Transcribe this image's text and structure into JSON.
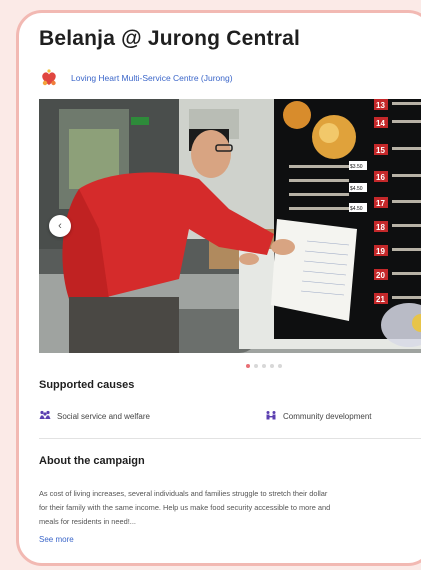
{
  "campaign": {
    "title": "Belanja @ Jurong Central",
    "organizer": "Loving Heart Multi-Service Centre (Jurong)"
  },
  "carousel": {
    "prev_label": "‹",
    "slide_count": 5,
    "active_index": 0
  },
  "supported_causes": {
    "heading": "Supported causes",
    "items": [
      {
        "label": "Social service and welfare",
        "icon": "people-icon",
        "color": "#5b3fb0"
      },
      {
        "label": "Community development",
        "icon": "community-icon",
        "color": "#5b3fb0"
      }
    ]
  },
  "about": {
    "heading": "About the campaign",
    "lines": [
      "As cost of living increases, several individuals and families struggle to stretch their dollar",
      "for their family with the same income. Help us make food security accessible to more and",
      "meals for residents in need!..."
    ],
    "see_more": "See more"
  },
  "menu_board": {
    "numbers": [
      "13",
      "14",
      "15",
      "16",
      "17",
      "18",
      "19",
      "20",
      "21"
    ],
    "prices": [
      "$3.50",
      "$4.50",
      "$4.50"
    ]
  },
  "colors": {
    "accent": "#e86f75",
    "link": "#3b66c9",
    "card_border": "#f2b9b3",
    "background": "#fbeae7"
  }
}
